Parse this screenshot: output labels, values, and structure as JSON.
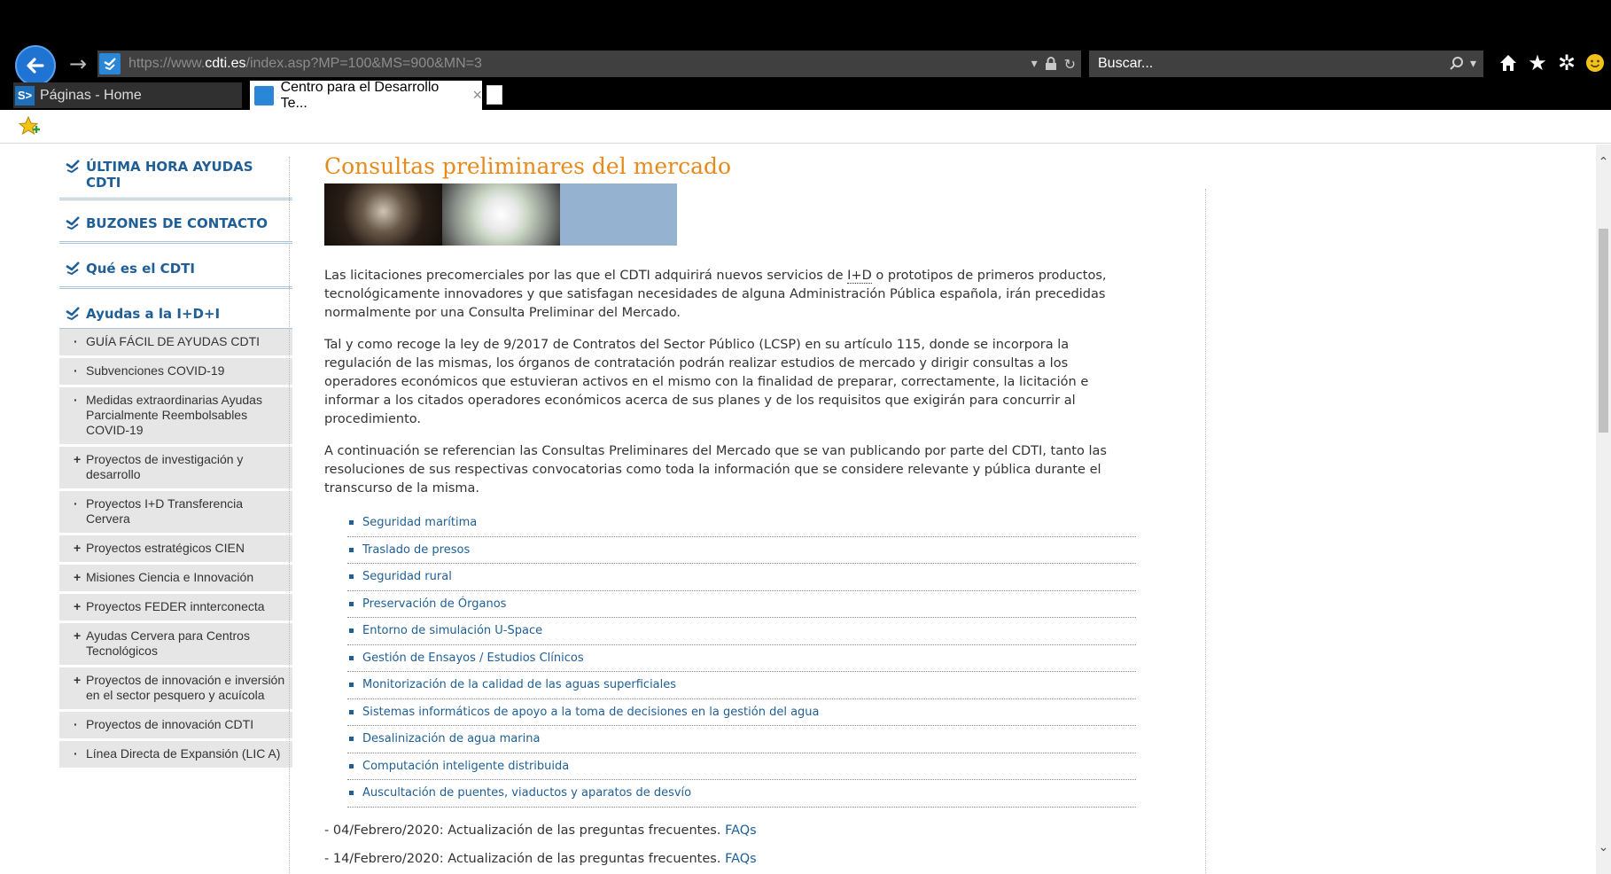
{
  "browser": {
    "url_prefix": "https://www.",
    "url_host": "cdti.es",
    "url_path": "/index.asp?MP=100&MS=900&MN=3",
    "search_placeholder": "Buscar...",
    "tabs": [
      {
        "label": "Páginas - Home",
        "icon_text": "S>"
      },
      {
        "label": "Centro para el Desarrollo Te...",
        "close": "×"
      }
    ],
    "icons": [
      "back-icon",
      "forward-icon",
      "dropdown-icon",
      "lock-icon",
      "refresh-icon",
      "search-icon",
      "home-icon",
      "favorites-icon",
      "gear-icon",
      "smiley-icon",
      "favorites-add-icon"
    ]
  },
  "nav": {
    "main": [
      "ÚLTIMA HORA AYUDAS CDTI",
      "BUZONES DE CONTACTO",
      "Qué es el CDTI",
      "Ayudas a la I+D+I"
    ],
    "sub": [
      {
        "bullet": "·",
        "label": "GUÍA FÁCIL DE AYUDAS CDTI"
      },
      {
        "bullet": "·",
        "label": "Subvenciones COVID-19"
      },
      {
        "bullet": "·",
        "label": "Medidas extraordinarias Ayudas Parcialmente Reembolsables COVID-19"
      },
      {
        "bullet": "+",
        "label": "Proyectos de investigación y desarrollo"
      },
      {
        "bullet": "·",
        "label": "Proyectos I+D Transferencia Cervera"
      },
      {
        "bullet": "+",
        "label": "Proyectos estratégicos CIEN"
      },
      {
        "bullet": "+",
        "label": "Misiones Ciencia e Innovación"
      },
      {
        "bullet": "+",
        "label": "Proyectos FEDER innterconecta"
      },
      {
        "bullet": "+",
        "label": "Ayudas Cervera para Centros Tecnológicos"
      },
      {
        "bullet": "+",
        "label": "Proyectos de innovación e inversión en el sector pesquero y acuícola"
      },
      {
        "bullet": "·",
        "label": "Proyectos de innovación CDTI"
      },
      {
        "bullet": "·",
        "label": "Línea Directa de Expansión (LIC A)"
      }
    ]
  },
  "content": {
    "title": "Consultas preliminares del mercado",
    "para1_a": "Las licitaciones precomerciales por las que el CDTI adquirirá nuevos servicios de ",
    "para1_abbr": "I+D",
    "para1_b": " o prototipos de primeros productos, tecnológicamente innovadores y que satisfagan necesidades de alguna Administración Pública española, irán precedidas normalmente por una Consulta Preliminar del Mercado.",
    "para2": "Tal y como recoge la ley de 9/2017 de Contratos del Sector Público (LCSP) en su artículo 115, donde se incorpora la regulación de las mismas, los órganos de contratación podrán realizar estudios de mercado y dirigir consultas a los operadores económicos que estuvieran activos en el mismo con la finalidad de preparar, correctamente, la licitación e informar a los citados operadores económicos acerca de sus planes y de los requisitos que exigirán para concurrir al procedimiento.",
    "para3": "A continuación se referencian las Consultas Preliminares del Mercado que se van publicando por parte del CDTI, tanto las resoluciones de sus respectivas convocatorias como toda la información que se considere relevante y pública durante el transcurso de la misma.",
    "consultas": [
      "Seguridad marítima",
      "Traslado de presos",
      "Seguridad rural",
      "Preservación de Órganos",
      "Entorno de simulación U-Space",
      "Gestión de Ensayos / Estudios Clínicos",
      "Monitorización de la calidad de las aguas superficiales",
      "Sistemas informáticos de apoyo a la toma de decisiones en la gestión del agua",
      "Desalinización de agua marina",
      "Computación inteligente distribuida",
      "Auscultación de puentes, viaductos y aparatos de desvío"
    ],
    "news1_text": "- 04/Febrero/2020: Actualización de las preguntas frecuentes. ",
    "news1_link": "FAQs",
    "news2_text": "- 14/Febrero/2020: Actualización de las preguntas frecuentes. ",
    "news2_link": "FAQs"
  },
  "colors": {
    "accent_orange": "#e68a1c",
    "link_blue": "#1f5f95",
    "nav_sub_bg": "#e6e6e6",
    "chrome_bg": "#000000"
  }
}
